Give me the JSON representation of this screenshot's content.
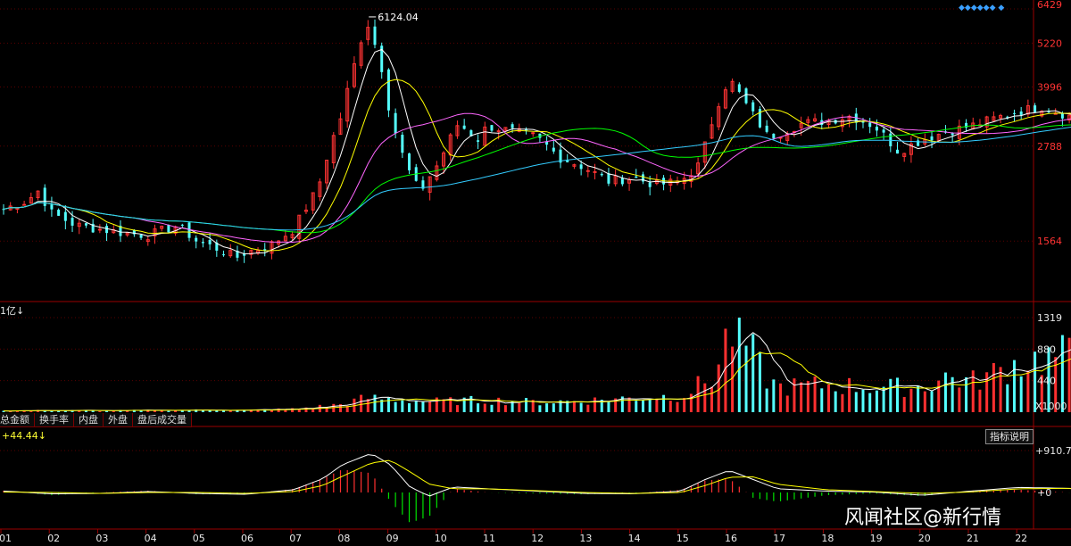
{
  "chart_data": [
    {
      "type": "candlestick",
      "scale": "log",
      "y_ticks": [
        1564,
        2788,
        3996,
        5220,
        6429
      ],
      "ylim": [
        1100,
        6429
      ],
      "x_ticks": [
        "01",
        "02",
        "03",
        "04",
        "05",
        "06",
        "07",
        "08",
        "09",
        "10",
        "11",
        "12",
        "13",
        "14",
        "15",
        "16",
        "17",
        "18",
        "19",
        "20",
        "21",
        "22"
      ],
      "max_annotation": "6124.04",
      "up_color": "#ff3333",
      "down_color": "#54ffff",
      "ma_colors": [
        "#ffffff",
        "#ffff00",
        "#ff66ff",
        "#00ff00",
        "#33ccff"
      ],
      "close_path": [
        [
          0.0,
          1900
        ],
        [
          0.5,
          2000
        ],
        [
          0.7,
          2130
        ],
        [
          1.0,
          1850
        ],
        [
          1.5,
          1720
        ],
        [
          2.0,
          1680
        ],
        [
          2.5,
          1640
        ],
        [
          3.0,
          1620
        ],
        [
          3.6,
          1720
        ],
        [
          4.0,
          1560
        ],
        [
          4.5,
          1480
        ],
        [
          4.8,
          1410
        ],
        [
          5.0,
          1460
        ],
        [
          5.5,
          1520
        ],
        [
          6.0,
          1680
        ],
        [
          6.5,
          2150
        ],
        [
          7.0,
          3400
        ],
        [
          7.3,
          4800
        ],
        [
          7.5,
          6000
        ],
        [
          7.8,
          4600
        ],
        [
          8.0,
          3300
        ],
        [
          8.3,
          2500
        ],
        [
          8.6,
          2100
        ],
        [
          9.0,
          2520
        ],
        [
          9.4,
          3200
        ],
        [
          9.8,
          2900
        ],
        [
          10.0,
          3150
        ],
        [
          10.5,
          3050
        ],
        [
          11.0,
          2950
        ],
        [
          11.5,
          2600
        ],
        [
          12.0,
          2450
        ],
        [
          12.5,
          2250
        ],
        [
          13.0,
          2300
        ],
        [
          13.5,
          2200
        ],
        [
          14.0,
          2250
        ],
        [
          14.4,
          2500
        ],
        [
          14.8,
          3700
        ],
        [
          15.0,
          4200
        ],
        [
          15.4,
          3500
        ],
        [
          15.8,
          2950
        ],
        [
          16.0,
          3000
        ],
        [
          16.5,
          3200
        ],
        [
          17.0,
          3250
        ],
        [
          17.5,
          3350
        ],
        [
          18.0,
          3150
        ],
        [
          18.5,
          2700
        ],
        [
          19.0,
          2900
        ],
        [
          19.5,
          3050
        ],
        [
          20.0,
          3150
        ],
        [
          20.5,
          3300
        ],
        [
          21.0,
          3450
        ],
        [
          21.5,
          3550
        ],
        [
          22.0,
          3350
        ],
        [
          22.6,
          3300
        ]
      ]
    },
    {
      "type": "bar",
      "unit_label": "1亿",
      "unit_suffix": "X1000",
      "y_ticks": [
        440,
        880,
        1319
      ],
      "ylim": [
        0,
        1319
      ],
      "volume_path": [
        [
          0.0,
          20
        ],
        [
          1.0,
          25
        ],
        [
          2.0,
          20
        ],
        [
          3.0,
          25
        ],
        [
          4.0,
          30
        ],
        [
          5.0,
          28
        ],
        [
          6.0,
          45
        ],
        [
          7.0,
          110
        ],
        [
          7.5,
          200
        ],
        [
          8.0,
          180
        ],
        [
          9.0,
          150
        ],
        [
          10.0,
          170
        ],
        [
          11.0,
          140
        ],
        [
          12.0,
          160
        ],
        [
          13.0,
          200
        ],
        [
          14.0,
          230
        ],
        [
          14.7,
          500
        ],
        [
          15.0,
          1150
        ],
        [
          15.3,
          1000
        ],
        [
          15.8,
          450
        ],
        [
          16.0,
          350
        ],
        [
          17.0,
          380
        ],
        [
          18.0,
          350
        ],
        [
          19.0,
          350
        ],
        [
          19.5,
          500
        ],
        [
          20.0,
          420
        ],
        [
          20.5,
          550
        ],
        [
          21.0,
          700
        ],
        [
          21.5,
          750
        ],
        [
          22.0,
          800
        ],
        [
          22.6,
          720
        ]
      ]
    },
    {
      "type": "macd",
      "value_label": "+44.44↓",
      "y_ticks": [
        "+910.7",
        "+0"
      ],
      "ylim": [
        -400,
        910.7
      ],
      "dif_path": [
        [
          0.0,
          30
        ],
        [
          1.0,
          -30
        ],
        [
          2.0,
          -20
        ],
        [
          3.0,
          20
        ],
        [
          4.0,
          -20
        ],
        [
          5.0,
          -40
        ],
        [
          6.0,
          60
        ],
        [
          6.6,
          300
        ],
        [
          7.0,
          600
        ],
        [
          7.6,
          850
        ],
        [
          8.0,
          600
        ],
        [
          8.4,
          120
        ],
        [
          8.8,
          -80
        ],
        [
          9.3,
          120
        ],
        [
          10.0,
          80
        ],
        [
          11.0,
          30
        ],
        [
          12.0,
          -20
        ],
        [
          13.0,
          -30
        ],
        [
          14.0,
          30
        ],
        [
          14.5,
          280
        ],
        [
          15.0,
          480
        ],
        [
          15.5,
          280
        ],
        [
          16.0,
          80
        ],
        [
          17.0,
          30
        ],
        [
          18.0,
          10
        ],
        [
          19.0,
          -60
        ],
        [
          20.0,
          30
        ],
        [
          21.0,
          110
        ],
        [
          22.0,
          90
        ],
        [
          22.6,
          40
        ]
      ],
      "dea_path": [
        [
          0.0,
          10
        ],
        [
          1.0,
          0
        ],
        [
          2.0,
          -20
        ],
        [
          3.0,
          0
        ],
        [
          4.0,
          0
        ],
        [
          5.0,
          -20
        ],
        [
          6.0,
          20
        ],
        [
          6.6,
          150
        ],
        [
          7.0,
          350
        ],
        [
          7.6,
          640
        ],
        [
          8.0,
          700
        ],
        [
          8.4,
          450
        ],
        [
          8.8,
          180
        ],
        [
          9.3,
          80
        ],
        [
          10.0,
          80
        ],
        [
          11.0,
          40
        ],
        [
          12.0,
          0
        ],
        [
          13.0,
          -20
        ],
        [
          14.0,
          0
        ],
        [
          14.5,
          150
        ],
        [
          15.0,
          330
        ],
        [
          15.5,
          340
        ],
        [
          16.0,
          180
        ],
        [
          17.0,
          60
        ],
        [
          18.0,
          20
        ],
        [
          19.0,
          -20
        ],
        [
          20.0,
          10
        ],
        [
          21.0,
          80
        ],
        [
          22.0,
          90
        ],
        [
          22.6,
          60
        ]
      ]
    }
  ],
  "ui": {
    "tabs": [
      "总金额",
      "换手率",
      "内盘",
      "外盘",
      "盘后成交量"
    ],
    "indicator_button": "指标说明",
    "watermark": "风闻社区@新行情"
  }
}
